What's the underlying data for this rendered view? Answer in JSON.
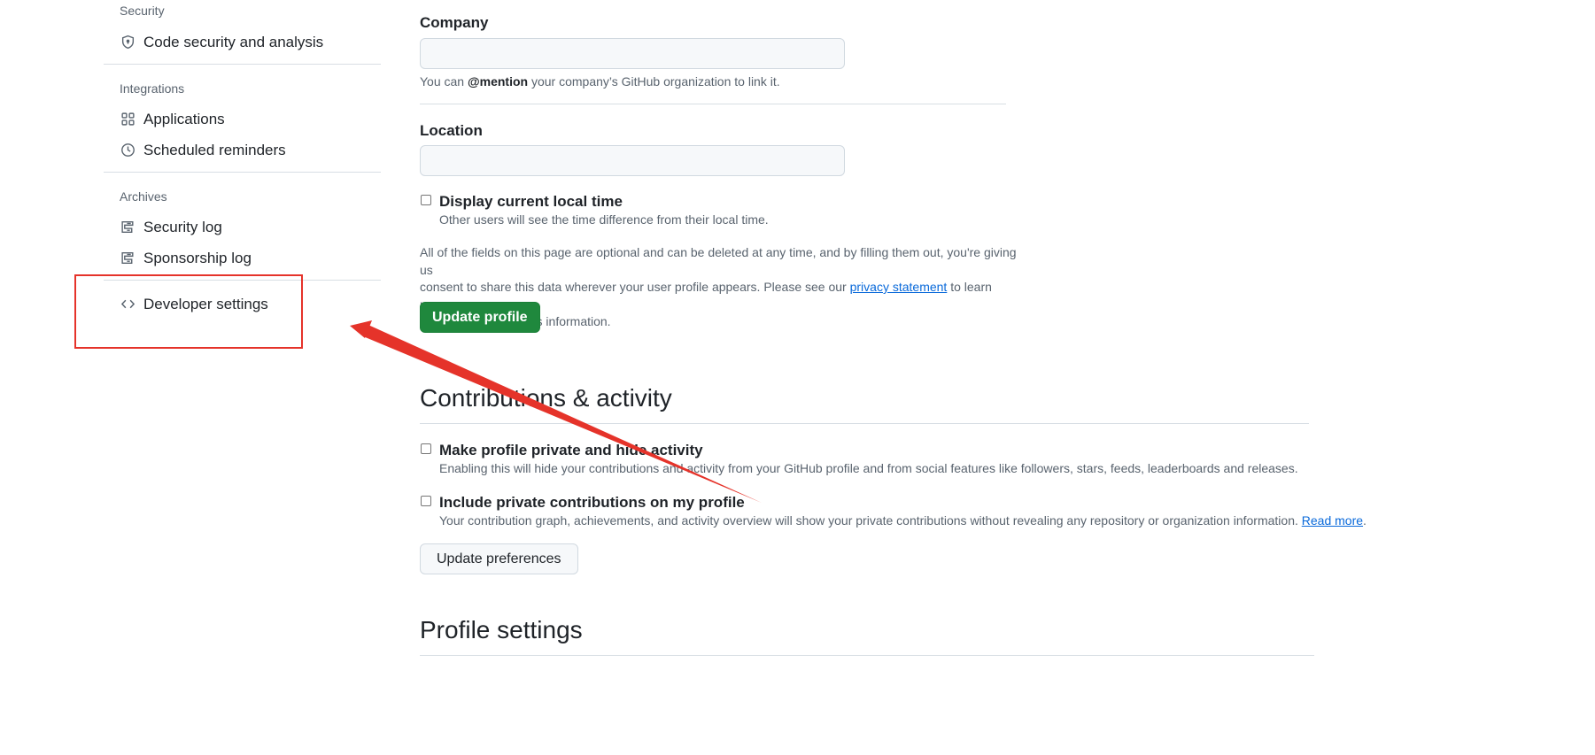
{
  "sidebar": {
    "sections": {
      "security": {
        "heading": "Security",
        "items": [
          "Code security and analysis"
        ]
      },
      "integrations": {
        "heading": "Integrations",
        "items": [
          "Applications",
          "Scheduled reminders"
        ]
      },
      "archives": {
        "heading": "Archives",
        "items": [
          "Security log",
          "Sponsorship log"
        ]
      }
    },
    "developer_settings": "Developer settings"
  },
  "profile_form": {
    "company_label": "Company",
    "company_value": "",
    "company_note_prefix": "You can",
    "company_note_mention": "@mention",
    "company_note_suffix": "your company’s GitHub organization to link it.",
    "location_label": "Location",
    "location_value": "",
    "local_time_label": "Display current local time",
    "local_time_note": "Other users will see the time difference from their local time.",
    "disclaimer_line1": "All of the fields on this page are optional and can be deleted at any time, and by filling them out, you're giving us",
    "disclaimer_line2_prefix": "consent to share this data wherever your user profile appears. Please see our",
    "privacy_link": "privacy statement",
    "disclaimer_line2_suffix": "to learn more",
    "disclaimer_line3": "about how we use this information.",
    "update_button": "Update profile"
  },
  "contributions": {
    "heading": "Contributions & activity",
    "private_label": "Make profile private and hide activity",
    "private_note": "Enabling this will hide your contributions and activity from your GitHub profile and from social features like followers, stars, feeds, leaderboards and releases.",
    "include_label": "Include private contributions on my profile",
    "include_note": "Your contribution graph, achievements, and activity overview will show your private contributions without revealing any repository or organization information.",
    "read_more": "Read more",
    "period": ".",
    "update_button": "Update preferences"
  },
  "profile_settings": {
    "heading": "Profile settings"
  },
  "annotation": {
    "box_color": "#e5332a",
    "arrow_color": "#e5332a"
  }
}
